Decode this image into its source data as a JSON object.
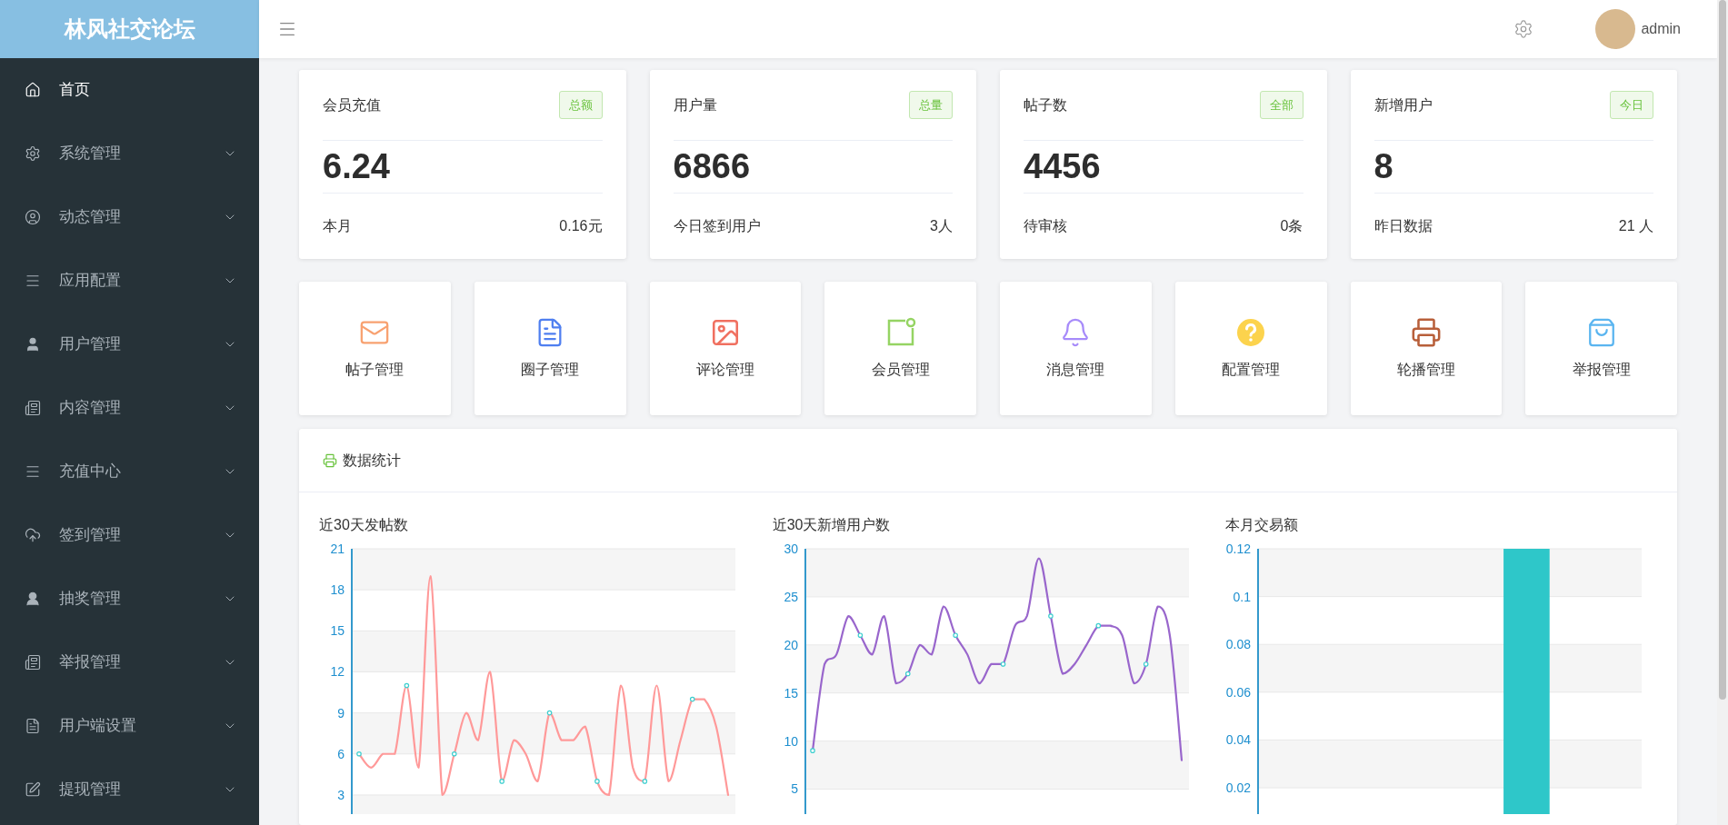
{
  "header": {
    "logo": "林风社交论坛",
    "username": "admin"
  },
  "sidebar": {
    "items": [
      {
        "label": "首页",
        "selected": true,
        "expandable": false
      },
      {
        "label": "系统管理",
        "selected": false,
        "expandable": true
      },
      {
        "label": "动态管理",
        "selected": false,
        "expandable": true
      },
      {
        "label": "应用配置",
        "selected": false,
        "expandable": true
      },
      {
        "label": "用户管理",
        "selected": false,
        "expandable": true
      },
      {
        "label": "内容管理",
        "selected": false,
        "expandable": true
      },
      {
        "label": "充值中心",
        "selected": false,
        "expandable": true
      },
      {
        "label": "签到管理",
        "selected": false,
        "expandable": true
      },
      {
        "label": "抽奖管理",
        "selected": false,
        "expandable": true
      },
      {
        "label": "举报管理",
        "selected": false,
        "expandable": true
      },
      {
        "label": "用户端设置",
        "selected": false,
        "expandable": true
      },
      {
        "label": "提现管理",
        "selected": false,
        "expandable": true
      }
    ]
  },
  "stats": [
    {
      "title": "会员充值",
      "badge": "总额",
      "value": "6.24",
      "footer_label": "本月",
      "footer_value": "0.16元"
    },
    {
      "title": "用户量",
      "badge": "总量",
      "value": "6866",
      "footer_label": "今日签到用户",
      "footer_value": "3人"
    },
    {
      "title": "帖子数",
      "badge": "全部",
      "value": "4456",
      "footer_label": "待审核",
      "footer_value": "0条"
    },
    {
      "title": "新增用户",
      "badge": "今日",
      "value": "8",
      "footer_label": "昨日数据",
      "footer_value": "21 人"
    }
  ],
  "shortcuts": [
    {
      "label": "帖子管理"
    },
    {
      "label": "圈子管理"
    },
    {
      "label": "评论管理"
    },
    {
      "label": "会员管理"
    },
    {
      "label": "消息管理"
    },
    {
      "label": "配置管理"
    },
    {
      "label": "轮播管理"
    },
    {
      "label": "举报管理"
    }
  ],
  "data_panel": {
    "title": "数据统计",
    "charts": [
      {
        "chart_data": {
          "type": "line",
          "grid": true,
          "title": "近30天发帖数",
          "ylim": [
            1.6,
            21
          ],
          "yticks": [
            3,
            6,
            9,
            12,
            15,
            18,
            21
          ],
          "series": [
            {
              "color": "#ff9999",
              "values": [
                6,
                5,
                6,
                6,
                11,
                5,
                19,
                3,
                6,
                9,
                7,
                12,
                4,
                7,
                6,
                4,
                9,
                7,
                7,
                8,
                4,
                3,
                11,
                5,
                4,
                11,
                4,
                7,
                10,
                10,
                8,
                3
              ]
            }
          ]
        }
      },
      {
        "chart_data": {
          "type": "line",
          "grid": true,
          "title": "近30天新增用户数",
          "ylim": [
            2.4,
            30
          ],
          "yticks": [
            5,
            10,
            15,
            20,
            25,
            30
          ],
          "series": [
            {
              "color": "#9966cc",
              "values": [
                9,
                18,
                19,
                23,
                21,
                19,
                23,
                16,
                17,
                20,
                19,
                24,
                21,
                19,
                16,
                18,
                18,
                22,
                23,
                29,
                23,
                17,
                18,
                20,
                22,
                22,
                21,
                16,
                18,
                24,
                21,
                8
              ]
            }
          ]
        }
      },
      {
        "chart_data": {
          "type": "bar",
          "grid": true,
          "title": "本月交易额",
          "ylim": [
            0.009,
            0.12
          ],
          "yticks": [
            0.02,
            0.04,
            0.06,
            0.08,
            0.1,
            0.12
          ],
          "series": [
            {
              "color": "#2ec7c9",
              "values": [
                null,
                null,
                null,
                0.12,
                null
              ]
            }
          ]
        }
      }
    ]
  }
}
